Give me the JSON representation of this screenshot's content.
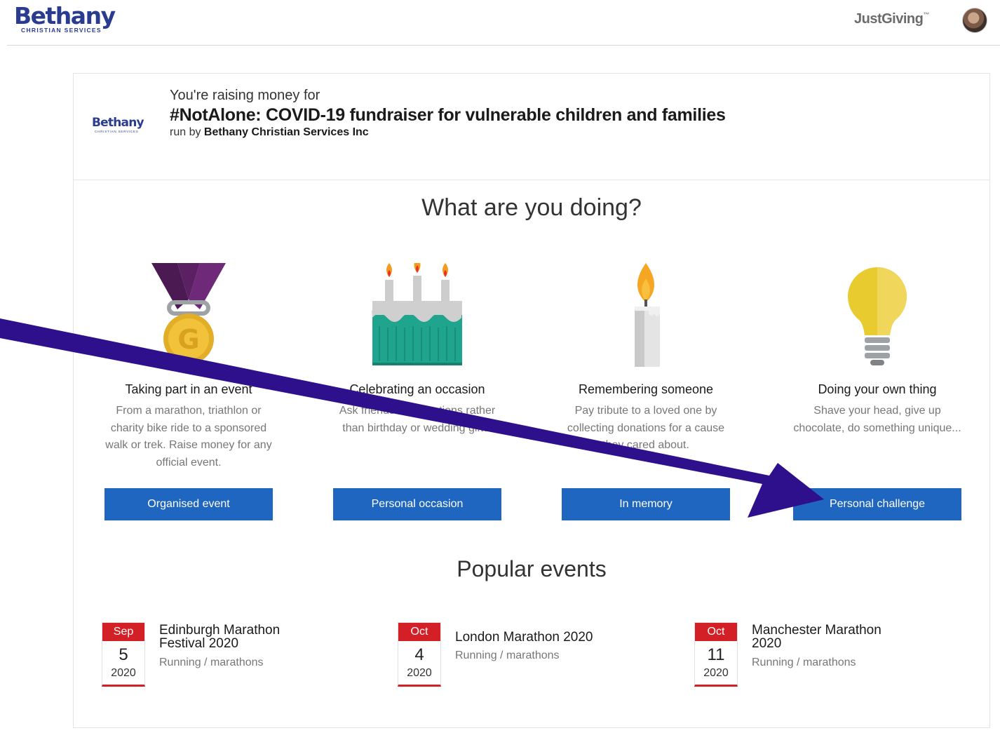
{
  "header": {
    "brand_name": "Bethany",
    "brand_sub": "CHRISTIAN SERVICES",
    "justgiving": "JustGiving"
  },
  "raising": {
    "logo_name": "Bethany",
    "logo_sub": "CHRISTIAN SERVICES",
    "label": "You're raising money for",
    "title": "#NotAlone: COVID-19 fundraiser for vulnerable children and families",
    "run_by_prefix": "run by",
    "run_by_name": "Bethany Christian Services Inc"
  },
  "doing": {
    "heading": "What are you doing?",
    "options": [
      {
        "title": "Taking part in an event",
        "desc": "From a marathon, triathlon or charity bike ride to a sponsored walk or trek. Raise money for any official event.",
        "button": "Organised event",
        "icon": "medal-icon"
      },
      {
        "title": "Celebrating an occasion",
        "desc": "Ask friends for donations rather than birthday or wedding gifts.",
        "button": "Personal occasion",
        "icon": "cake-icon"
      },
      {
        "title": "Remembering someone",
        "desc": "Pay tribute to a loved one by collecting donations for a cause they cared about.",
        "button": "In memory",
        "icon": "candle-icon"
      },
      {
        "title": "Doing your own thing",
        "desc": "Shave your head, give up chocolate, do something unique...",
        "button": "Personal challenge",
        "icon": "lightbulb-icon"
      }
    ]
  },
  "popular": {
    "heading": "Popular events",
    "events": [
      {
        "month": "Sep",
        "day": "5",
        "year": "2020",
        "name": "Edinburgh Marathon Festival 2020",
        "category": "Running / marathons"
      },
      {
        "month": "Oct",
        "day": "4",
        "year": "2020",
        "name": "London Marathon 2020",
        "category": "Running / marathons"
      },
      {
        "month": "Oct",
        "day": "11",
        "year": "2020",
        "name": "Manchester Marathon 2020",
        "category": "Running / marathons"
      }
    ]
  },
  "colors": {
    "brand": "#2a3c8f",
    "button": "#1f66c1",
    "calendar": "#d31f26",
    "arrow": "#2e0f8c"
  }
}
